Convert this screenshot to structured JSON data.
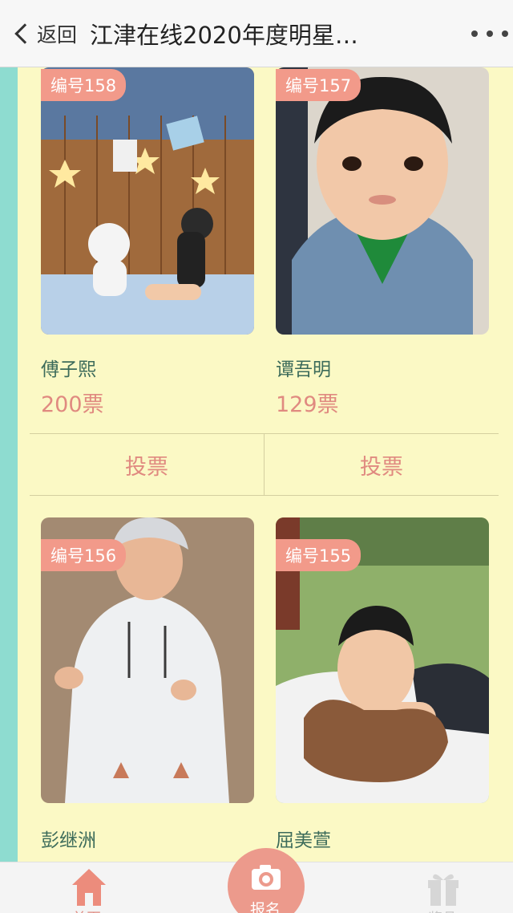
{
  "header": {
    "back_label": "返回",
    "title": "江津在线2020年度明星…",
    "more_icon": "more-dots-icon"
  },
  "colors": {
    "accent": "#e08a80",
    "background": "#fbf9c5",
    "stripe": "#8edcd0",
    "name_text": "#3c6b5a"
  },
  "cards": [
    {
      "badge": "编号158",
      "name": "傅子熙",
      "votes": "200票",
      "vote_label": "投票"
    },
    {
      "badge": "编号157",
      "name": "谭吾明",
      "votes": "129票",
      "vote_label": "投票"
    },
    {
      "badge": "编号156",
      "name": "彭继洲"
    },
    {
      "badge": "编号155",
      "name": "屈美萱"
    }
  ],
  "tabbar": {
    "home_label": "首页",
    "signup_label": "报名",
    "gift_label": "奖品"
  }
}
